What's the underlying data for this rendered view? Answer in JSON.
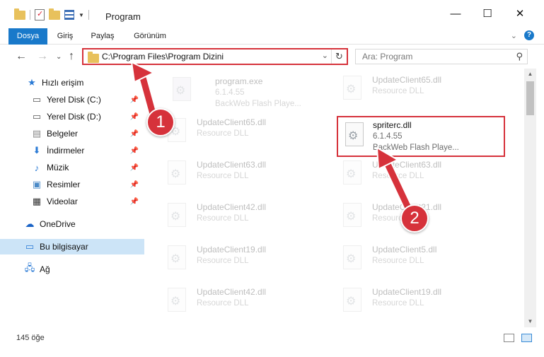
{
  "window": {
    "title": "Program",
    "minimize": "—",
    "maximize": "☐",
    "close": "✕"
  },
  "ribbon": {
    "tabs": [
      "Dosya",
      "Giriş",
      "Paylaş",
      "Görünüm"
    ],
    "help": "?"
  },
  "address": {
    "path": "C:\\Program Files\\Program Dizini",
    "search_placeholder": "Ara: Program"
  },
  "nav_pane": {
    "quick_access": "Hızlı erişim",
    "items": [
      {
        "label": "Yerel Disk (C:)",
        "icon": "drive-icon"
      },
      {
        "label": "Yerel Disk (D:)",
        "icon": "drive-icon"
      },
      {
        "label": "Belgeler",
        "icon": "documents-icon"
      },
      {
        "label": "İndirmeler",
        "icon": "download-icon"
      },
      {
        "label": "Müzik",
        "icon": "music-icon"
      },
      {
        "label": "Resimler",
        "icon": "pictures-icon"
      },
      {
        "label": "Videolar",
        "icon": "videos-icon"
      }
    ],
    "onedrive": "OneDrive",
    "this_pc": "Bu bilgisayar",
    "network": "Ağ"
  },
  "files": {
    "program_exe": {
      "name": "program.exe",
      "version": "6.1.4.55",
      "desc": "BackWeb Flash Playe..."
    },
    "spriterc": {
      "name": "spriterc.dll",
      "version": "6.1.4.55",
      "desc": "BackWeb Flash Playe..."
    },
    "resource_type": "Resource DLL",
    "col1": [
      "UpdateClient65.dll",
      "UpdateClient63.dll",
      "UpdateClient42.dll",
      "UpdateClient19.dll",
      "UpdateClient42.dll"
    ],
    "col2": [
      "UpdateClient65.dll",
      "UpdateClient63.dll",
      "UpdateClient21.dll",
      "UpdateClient5.dll",
      "UpdateClient19.dll"
    ]
  },
  "status": {
    "count": "145 öğe"
  },
  "annotations": {
    "step1": "1",
    "step2": "2"
  },
  "colors": {
    "accent": "#1979ca",
    "annotation": "#d6323b",
    "selected": "#cce4f7"
  }
}
